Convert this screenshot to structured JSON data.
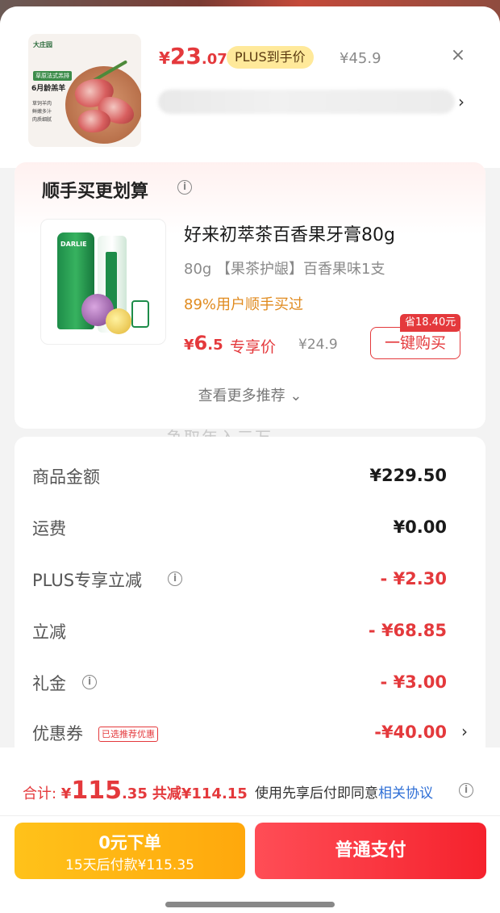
{
  "product": {
    "thumb_brand": "大庄园",
    "thumb_tag": "草原法式羔排",
    "thumb_age": "6月龄羔羊",
    "thumb_features": [
      "草饲羊肉",
      "鲜嫩多汁",
      "肉质细腻"
    ],
    "price_currency": "¥",
    "price_int": "23",
    "price_dec": ".07",
    "plus_label": "PLUS到手价",
    "original_price": "¥45.9",
    "close_icon": "×",
    "chevron": "›"
  },
  "recommend": {
    "title": "顺手买更划算",
    "info_icon": "i",
    "item": {
      "thumb_brand": "DARLIE",
      "name": "好来初萃茶百香果牙膏80g",
      "spec": "80g 【果茶护龈】百香果味1支",
      "social_proof": "89%用户顺手买过",
      "price_currency": "¥",
      "price_int": "6",
      "price_dec": ".5",
      "price_label": "专享价",
      "original_price": "¥24.9",
      "save_badge": "省18.40元",
      "buy_label": "一键购买"
    },
    "more_label": "查看更多推荐 ⌄"
  },
  "watermark": "争取年入三万",
  "summary": {
    "rows": [
      {
        "label": "商品金额",
        "value": "¥229.50",
        "red": false,
        "info": false
      },
      {
        "label": "运费",
        "value": "¥0.00",
        "red": false,
        "info": false
      },
      {
        "label": "PLUS专享立减",
        "value": "- ¥2.30",
        "red": true,
        "info": true
      },
      {
        "label": "立减",
        "value": "- ¥68.85",
        "red": true,
        "info": false
      },
      {
        "label": "礼金",
        "value": "- ¥3.00",
        "red": true,
        "info": true
      },
      {
        "label": "优惠券",
        "value": "-¥40.00",
        "red": true,
        "info": false,
        "badge": "已选推荐优惠",
        "chevron": "›"
      }
    ]
  },
  "footer": {
    "total_label": "合计: ",
    "total_currency": "¥",
    "total_int": "115",
    "total_dec": ".35",
    "saved": "共减¥114.15",
    "agree_text": "使用先享后付即同意",
    "agree_link": "相关协议",
    "pay_later_line1": "0元下单",
    "pay_later_line2": "15天后付款¥115.35",
    "pay_now_label": "普通支付"
  },
  "colors": {
    "accent_red": "#e4393c",
    "plus_yellow": "#ffe99a",
    "pay_later_orange": "#ffb313",
    "link_blue": "#2f6fd6",
    "social_orange": "#e08a1e"
  }
}
